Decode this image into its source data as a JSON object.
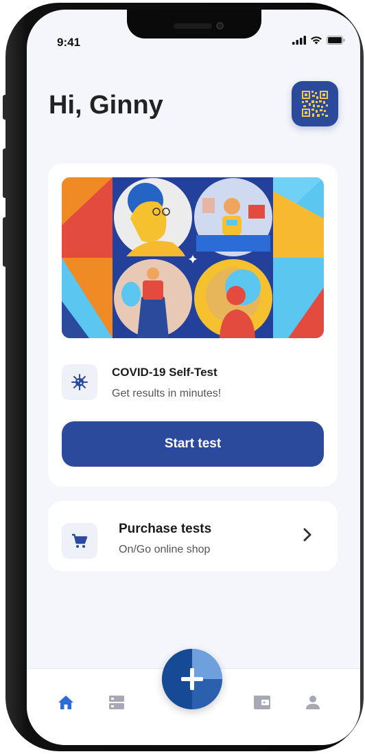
{
  "status_bar": {
    "time": "9:41"
  },
  "header": {
    "greeting": "Hi, Ginny",
    "qr_icon": "qr-code-icon"
  },
  "test_card": {
    "icon": "virus-icon",
    "title": "COVID-19 Self-Test",
    "subtitle": "Get results in minutes!",
    "button_label": "Start test"
  },
  "purchase_card": {
    "icon": "cart-icon",
    "title": "Purchase tests",
    "subtitle": "On/Go online shop"
  },
  "tab_bar": {
    "items": [
      "home-icon",
      "list-icon",
      "add-icon",
      "wallet-icon",
      "profile-icon"
    ],
    "active": "home-icon"
  },
  "colors": {
    "primary": "#2b4a9b",
    "active_tab": "#2b6cd6",
    "inactive_tab": "#a6a9b3",
    "background": "#f5f6fb"
  }
}
